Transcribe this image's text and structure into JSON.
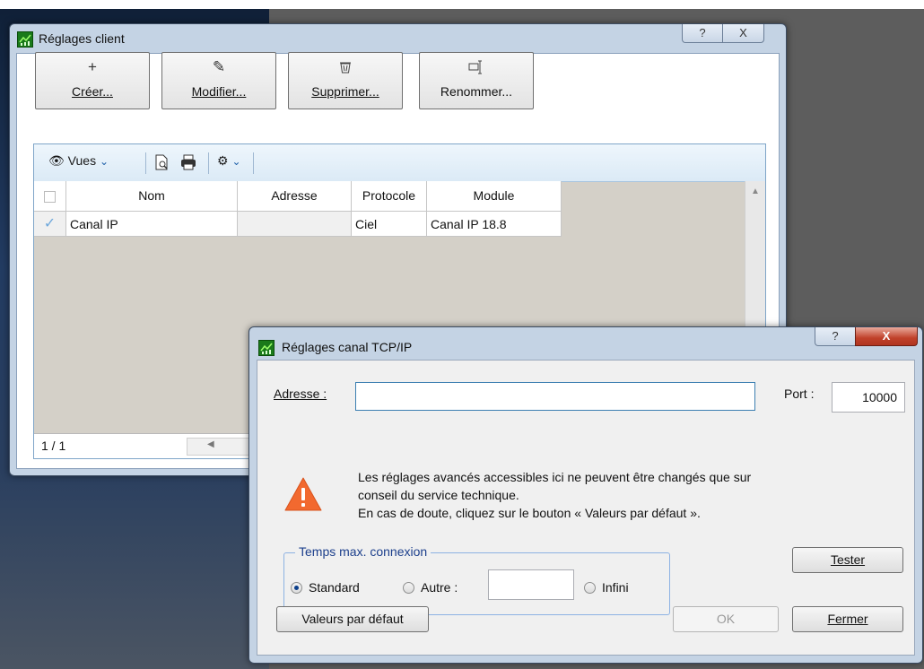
{
  "client_window": {
    "title": "Réglages client",
    "help_button": "?",
    "close_button": "X",
    "toolbar_buttons": [
      {
        "glyph": "+",
        "label": "Créer..."
      },
      {
        "glyph": "✎",
        "label": "Modifier..."
      },
      {
        "glyph": "🗑",
        "label": "Supprimer..."
      },
      {
        "glyph": "⌸",
        "label": "Renommer..."
      }
    ],
    "list_toolbar": {
      "views_label": "Vues",
      "icons": [
        "eye-icon",
        "preview-icon",
        "print-icon",
        "settings-gear-icon"
      ]
    },
    "columns": [
      "Nom",
      "Adresse",
      "Protocole",
      "Module"
    ],
    "rows": [
      {
        "checked": true,
        "nom": "Canal IP",
        "adresse": "",
        "protocole": "Ciel",
        "module": "Canal IP 18.8"
      }
    ],
    "pager": "1 / 1"
  },
  "tcp_dialog": {
    "title": "Réglages canal TCP/IP",
    "help_button": "?",
    "close_button": "X",
    "address_label": "Adresse :",
    "address_value": "",
    "port_label": "Port :",
    "port_value": "10000",
    "warning_lines": [
      "Les réglages avancés accessibles ici ne peuvent être changés que sur",
      "conseil du service technique.",
      "En cas de doute, cliquez sur le bouton « Valeurs par défaut »."
    ],
    "group_title": "Temps max. connexion",
    "radio_standard": "Standard",
    "radio_other": "Autre :",
    "other_value": "",
    "radio_infinite": "Infini",
    "selected_radio": "Standard",
    "test_button": "Tester",
    "defaults_button": "Valeurs par défaut",
    "ok_button": "OK",
    "close_dialog_button": "Fermer"
  },
  "colors": {
    "title_bg": "#c4d3e4",
    "list_toolbar_bg": "#dbeaf6",
    "warning": "#f2692f",
    "close_red": "#c0412a"
  }
}
